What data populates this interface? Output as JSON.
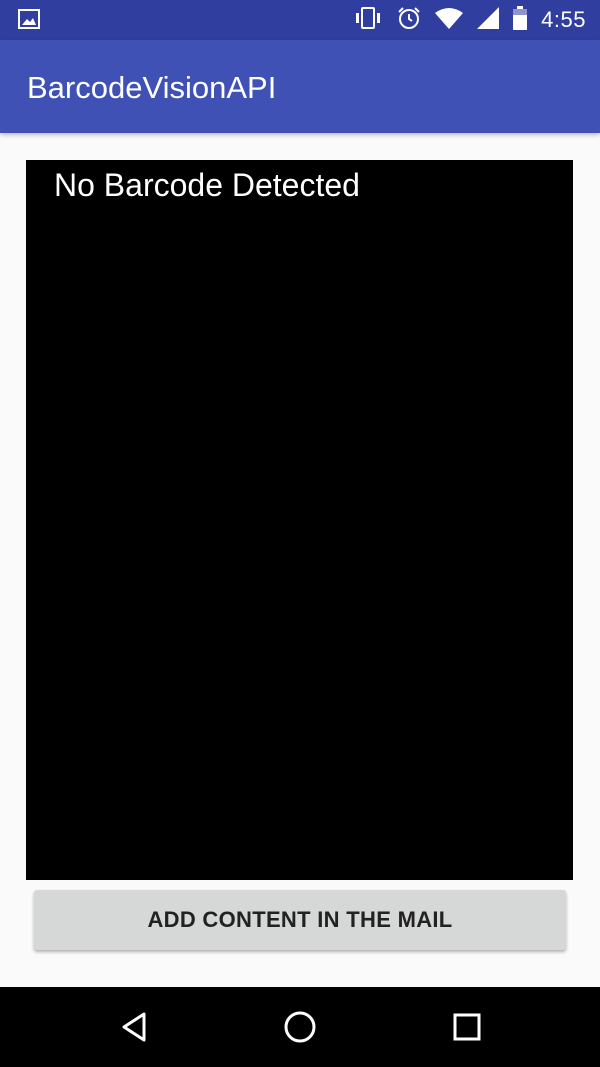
{
  "status_bar": {
    "time": "4:55",
    "icons": [
      "image-notification-icon",
      "vibrate-icon",
      "alarm-icon",
      "wifi-icon",
      "signal-icon",
      "battery-icon"
    ]
  },
  "app_bar": {
    "title": "BarcodeVisionAPI"
  },
  "camera": {
    "status_text": "No Barcode Detected"
  },
  "actions": {
    "add_content_label": "ADD CONTENT IN THE MAIL"
  },
  "nav_bar": {
    "icons": [
      "back-icon",
      "home-icon",
      "recents-icon"
    ]
  },
  "colors": {
    "status_bar": "#303f9f",
    "app_bar": "#3f51b5",
    "background": "#fafafa",
    "button": "#d6d7d7"
  }
}
